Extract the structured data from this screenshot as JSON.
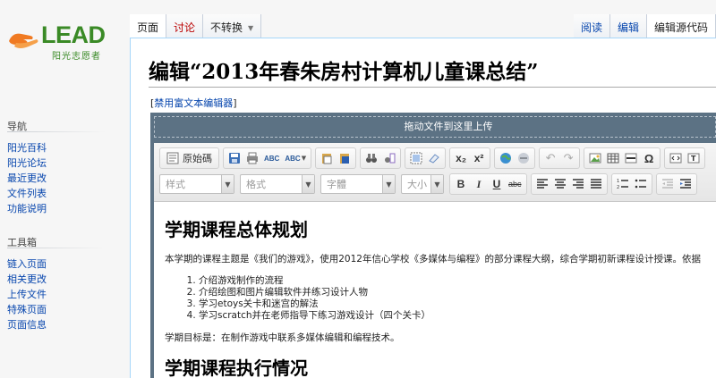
{
  "logo": {
    "brand": "LEAD",
    "subtitle": "阳光志愿者"
  },
  "sidebar": {
    "nav": {
      "heading": "导航",
      "items": [
        "阳光百科",
        "阳光论坛",
        "最近更改",
        "文件列表",
        "功能说明"
      ]
    },
    "tools": {
      "heading": "工具箱",
      "items": [
        "链入页面",
        "相关更改",
        "上传文件",
        "特殊页面",
        "页面信息"
      ]
    }
  },
  "tabs": {
    "left": [
      {
        "label": "页面"
      },
      {
        "label": "讨论"
      },
      {
        "label": "不转换"
      }
    ],
    "right": [
      {
        "label": "阅读"
      },
      {
        "label": "编辑"
      },
      {
        "label": "编辑源代码"
      }
    ]
  },
  "page": {
    "title": "编辑“2013年春朱房村计算机儿童课总结”",
    "disable_rich_prefix": "[",
    "disable_rich_link": "禁用富文本编辑器",
    "disable_rich_suffix": "]"
  },
  "editor": {
    "dropzone": "拖动文件到这里上传",
    "toolbar": {
      "source_label": "原始碼",
      "spell1": "ABC",
      "spell2": "ABC",
      "subscript": "x₂",
      "superscript": "x²",
      "omega": "Ω",
      "combos": [
        "样式",
        "格式",
        "字體",
        "大小"
      ],
      "bold": "B",
      "italic": "I",
      "underline": "U",
      "strike": "abc"
    },
    "content": {
      "heading1": "学期课程总体规划",
      "paragraph1": "本学期的课程主题是《我们的游戏》，使用2012年信心学校《多媒体与编程》的部分课程大纲，综合学期初新课程设计授课。依据",
      "list": [
        "介绍游戏制作的流程",
        "介绍绘图和图片编辑软件并练习设计人物",
        "学习etoys关卡和迷宫的解法",
        "学习scratch并在老师指导下练习游戏设计（四个关卡）"
      ],
      "paragraph2": "学期目标是：在制作游戏中联系多媒体编辑和编程技术。",
      "heading2": "学期课程执行情况"
    }
  },
  "colors": {
    "link": "#0645ad",
    "talk_red": "#ba0000",
    "brand_green": "#3a8a26",
    "brand_orange": "#f07a22",
    "editor_frame": "#5c7284"
  }
}
